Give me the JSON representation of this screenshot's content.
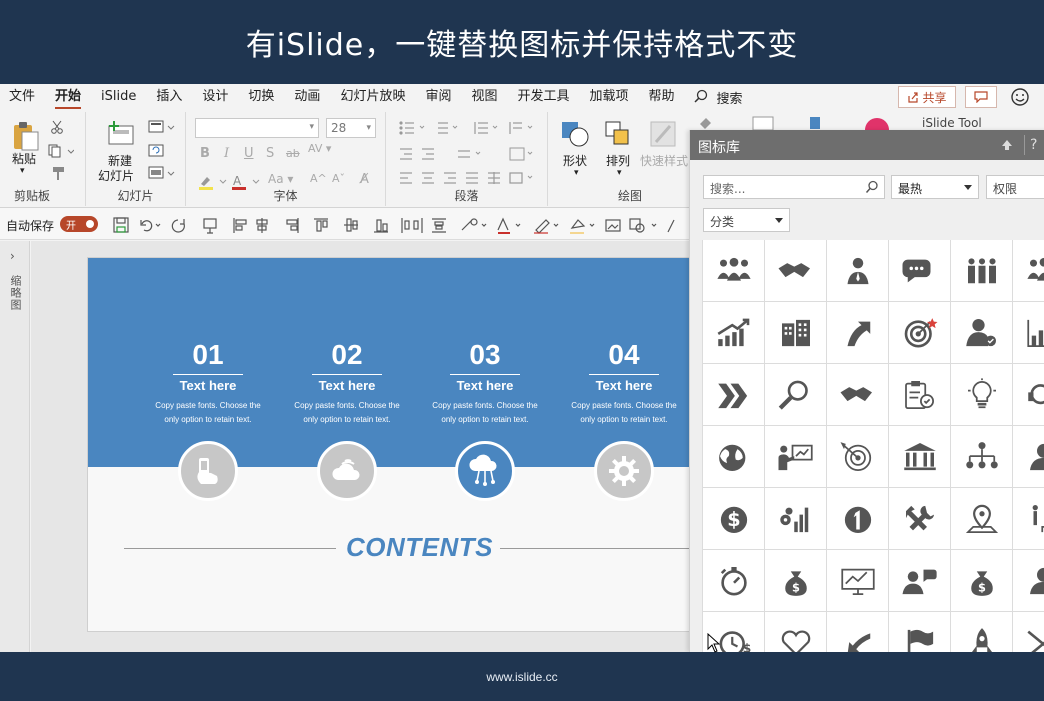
{
  "banner": {
    "title": "有iSlide，一键替换图标并保持格式不变"
  },
  "footer": {
    "url": "www.islide.cc"
  },
  "menubar": {
    "items": [
      "文件",
      "开始",
      "iSlide",
      "插入",
      "设计",
      "切换",
      "动画",
      "幻灯片放映",
      "审阅",
      "视图",
      "开发工具",
      "加载项",
      "帮助"
    ],
    "active": "开始",
    "search_label": "搜索",
    "share_label": "共享"
  },
  "ribbon": {
    "paste_label": "粘贴",
    "clipboard_label": "剪贴板",
    "new_slide_label": "新建",
    "new_slide_label2": "幻灯片",
    "slides_label": "幻灯片",
    "font_size": "28",
    "font_label": "字体",
    "paragraph_label": "段落",
    "shape_label": "形状",
    "arrange_label": "排列",
    "quick_style_label": "快速样式",
    "drawing_label": "绘图",
    "islide_tool_label": "iSlide Tool"
  },
  "qat": {
    "autosave_label": "自动保存",
    "toggle_state": "开"
  },
  "leftpane": {
    "label": "缩略图"
  },
  "slide": {
    "items": [
      {
        "num": "01",
        "title": "Text here",
        "desc": "Copy paste fonts. Choose the only option to retain text.",
        "icon": "phone-hand-icon",
        "highlight": false
      },
      {
        "num": "02",
        "title": "Text here",
        "desc": "Copy paste fonts. Choose the only option to retain text.",
        "icon": "cloud-wifi-icon",
        "highlight": false
      },
      {
        "num": "03",
        "title": "Text here",
        "desc": "Copy paste fonts. Choose the only option to retain text.",
        "icon": "cloud-network-icon",
        "highlight": true
      },
      {
        "num": "04",
        "title": "Text here",
        "desc": "Copy paste fonts. Choose the only option to retain text.",
        "icon": "gear-icon",
        "highlight": false
      }
    ],
    "contents_title": "CONTENTS",
    "colors": {
      "band": "#4a86c0",
      "circle": "#c7c7c7",
      "accent": "#4a86c0"
    }
  },
  "icon_panel": {
    "title": "图标库",
    "search_placeholder": "搜索...",
    "sort_value": "最热",
    "permission_placeholder": "权限",
    "category_value": "分类",
    "icons": [
      [
        "group-icon",
        "handshake-icon",
        "businessman-icon",
        "chat-bubbles-icon",
        "team-icon",
        "group-icon"
      ],
      [
        "growth-chart-icon",
        "building-icon",
        "arrow-up-curve-icon",
        "target-icon",
        "user-check-icon",
        "bar-chart-icon"
      ],
      [
        "double-chevron-icon",
        "magnifier-icon",
        "handshake-icon",
        "clipboard-check-icon",
        "lightbulb-icon",
        "headset-icon"
      ],
      [
        "globe-icon",
        "presenter-icon",
        "radar-icon",
        "bank-icon",
        "org-chart-icon",
        "user-icon"
      ],
      [
        "dollar-icon",
        "gears-chart-icon",
        "number-one-icon",
        "tools-icon",
        "location-pin-icon",
        "person-stairs-icon"
      ],
      [
        "stopwatch-icon",
        "money-bag-icon",
        "presentation-board-icon",
        "user-talk-icon",
        "money-bag-icon",
        "user-icon"
      ],
      [
        "clock-dollar-icon",
        "heart-icon",
        "arrow-back-icon",
        "flag-icon",
        "rocket-icon",
        "arrow-cross-icon"
      ]
    ]
  }
}
